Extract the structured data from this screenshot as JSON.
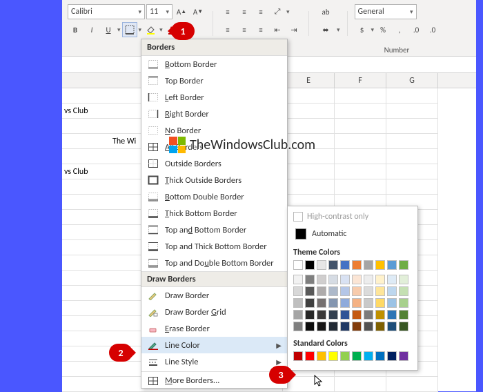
{
  "ribbon": {
    "font_name": "Calibri",
    "font_size": "11",
    "number_format": "General",
    "group_number_label": "Number",
    "bold": "B",
    "italic": "I",
    "underline": "U"
  },
  "columns": [
    "E",
    "F",
    "G"
  ],
  "cells": {
    "a_partial_1": "vs Club",
    "a_partial_2": "vs Club",
    "b_partial": "The Wi"
  },
  "menu": {
    "header": "Borders",
    "items": [
      {
        "key": "bottom",
        "label": "Bottom Border"
      },
      {
        "key": "top",
        "label": "Top Border"
      },
      {
        "key": "left",
        "label": "Left Border"
      },
      {
        "key": "right",
        "label": "Right Border"
      },
      {
        "key": "none",
        "label": "No Border"
      },
      {
        "key": "all",
        "label": "All Borders"
      },
      {
        "key": "outside",
        "label": "Outside Borders"
      },
      {
        "key": "thickoutside",
        "label": "Thick Outside Borders"
      },
      {
        "key": "bottomdouble",
        "label": "Bottom Double Border"
      },
      {
        "key": "thickbottom",
        "label": "Thick Bottom Border"
      },
      {
        "key": "topbottom",
        "label": "Top and Bottom Border"
      },
      {
        "key": "topthickbottom",
        "label": "Top and Thick Bottom Border"
      },
      {
        "key": "topdoublebottom",
        "label": "Top and Double Bottom Border"
      }
    ],
    "draw_header": "Draw Borders",
    "draw_items": [
      {
        "key": "draw",
        "label": "Draw Border"
      },
      {
        "key": "drawgrid",
        "label": "Draw Border Grid"
      },
      {
        "key": "erase",
        "label": "Erase Border"
      },
      {
        "key": "linecolor",
        "label": "Line Color",
        "submenu": true,
        "highlight": true
      },
      {
        "key": "linestyle",
        "label": "Line Style",
        "submenu": true
      },
      {
        "key": "more",
        "label": "More Borders..."
      }
    ]
  },
  "colors": {
    "hc_label": "High-contrast only",
    "auto_label": "Automatic",
    "theme_header": "Theme Colors",
    "theme_row": [
      "#ffffff",
      "#000000",
      "#e7e6e6",
      "#44546a",
      "#4472c4",
      "#ed7d31",
      "#a5a5a5",
      "#ffc000",
      "#5b9bd5",
      "#70ad47"
    ],
    "theme_shades": [
      [
        "#f2f2f2",
        "#7f7f7f",
        "#d0cece",
        "#d6dce4",
        "#d9e2f3",
        "#fbe5d5",
        "#ededed",
        "#fff2cc",
        "#deebf6",
        "#e2efd9"
      ],
      [
        "#d8d8d8",
        "#595959",
        "#aeabab",
        "#adb9ca",
        "#b4c6e7",
        "#f7cbac",
        "#dbdbdb",
        "#fee599",
        "#bdd7ee",
        "#c5e0b3"
      ],
      [
        "#bfbfbf",
        "#3f3f3f",
        "#757070",
        "#8496b0",
        "#8eaadb",
        "#f4b183",
        "#c9c9c9",
        "#ffd965",
        "#9cc3e5",
        "#a8d08d"
      ],
      [
        "#a5a5a5",
        "#262626",
        "#3a3838",
        "#323f4f",
        "#2f5496",
        "#c55a11",
        "#7b7b7b",
        "#bf9000",
        "#2e75b5",
        "#538135"
      ],
      [
        "#7f7f7f",
        "#0c0c0c",
        "#171616",
        "#222a35",
        "#1f3864",
        "#833c0b",
        "#525252",
        "#7f6000",
        "#1e4e79",
        "#375623"
      ]
    ],
    "standard_header": "Standard Colors",
    "standard_row": [
      "#c00000",
      "#ff0000",
      "#ffc000",
      "#ffff00",
      "#92d050",
      "#00b050",
      "#00b0f0",
      "#0070c0",
      "#002060",
      "#7030a0"
    ]
  },
  "callouts": {
    "c1": "1",
    "c2": "2",
    "c3": "3"
  },
  "watermark": "TheWindowsClub.com"
}
